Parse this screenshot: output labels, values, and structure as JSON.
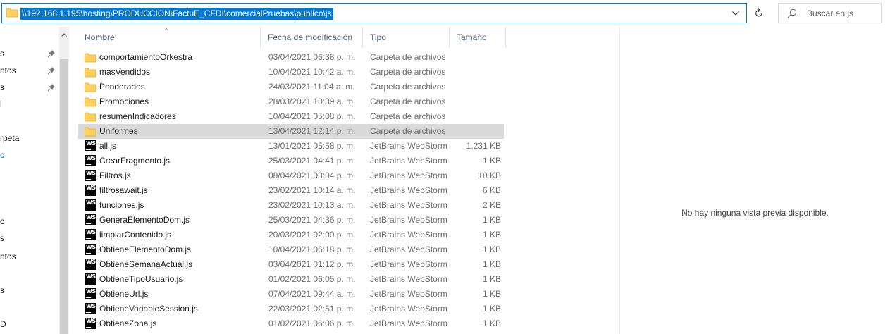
{
  "address_bar": {
    "path": "\\\\192.168.1.195\\hosting\\PRODUCCION\\FactuE_CFDI\\comercialPruebas\\publico\\js"
  },
  "search": {
    "placeholder": "Buscar en js"
  },
  "nav_pane": {
    "items": [
      {
        "label": "s",
        "pinned": true
      },
      {
        "label": "ntos",
        "pinned": true
      },
      {
        "label": "s",
        "pinned": true
      },
      {
        "label": "l",
        "pinned": false
      },
      {
        "label": "rpeta",
        "pinned": false
      },
      {
        "label": "c",
        "pinned": false,
        "blue": true
      },
      {
        "label": "o",
        "pinned": false
      },
      {
        "label": "s",
        "pinned": false
      },
      {
        "label": "ntos",
        "pinned": false
      },
      {
        "label": "s",
        "pinned": false
      },
      {
        "label": "D",
        "pinned": false
      }
    ]
  },
  "columns": {
    "name": "Nombre",
    "date": "Fecha de modificación",
    "type": "Tipo",
    "size": "Tamaño"
  },
  "files": [
    {
      "name": "comportamientoOrkestra",
      "date": "03/04/2021 06:38 p. m.",
      "type": "Carpeta de archivos",
      "size": "",
      "icon": "folder"
    },
    {
      "name": "masVendidos",
      "date": "10/04/2021 10:42 a. m.",
      "type": "Carpeta de archivos",
      "size": "",
      "icon": "folder"
    },
    {
      "name": "Ponderados",
      "date": "24/03/2021 11:04 a. m.",
      "type": "Carpeta de archivos",
      "size": "",
      "icon": "folder"
    },
    {
      "name": "Promociones",
      "date": "28/03/2021 10:39 a. m.",
      "type": "Carpeta de archivos",
      "size": "",
      "icon": "folder"
    },
    {
      "name": "resumenIndicadores",
      "date": "10/04/2021 05:08 p. m.",
      "type": "Carpeta de archivos",
      "size": "",
      "icon": "folder"
    },
    {
      "name": "Uniformes",
      "date": "13/04/2021 12:14 p. m.",
      "type": "Carpeta de archivos",
      "size": "",
      "icon": "folder",
      "selected": true
    },
    {
      "name": "all.js",
      "date": "13/01/2021 05:58 p. m.",
      "type": "JetBrains WebStorm",
      "size": "1,231 KB",
      "icon": "webstorm"
    },
    {
      "name": "CrearFragmento.js",
      "date": "25/03/2021 04:41 p. m.",
      "type": "JetBrains WebStorm",
      "size": "1 KB",
      "icon": "webstorm"
    },
    {
      "name": "Filtros.js",
      "date": "08/04/2021 03:04 p. m.",
      "type": "JetBrains WebStorm",
      "size": "10 KB",
      "icon": "webstorm"
    },
    {
      "name": "filtrosawait.js",
      "date": "23/02/2021 10:14 a. m.",
      "type": "JetBrains WebStorm",
      "size": "6 KB",
      "icon": "webstorm"
    },
    {
      "name": "funciones.js",
      "date": "23/02/2021 10:13 a. m.",
      "type": "JetBrains WebStorm",
      "size": "2 KB",
      "icon": "webstorm"
    },
    {
      "name": "GeneraElementoDom.js",
      "date": "25/03/2021 04:36 p. m.",
      "type": "JetBrains WebStorm",
      "size": "1 KB",
      "icon": "webstorm"
    },
    {
      "name": "limpiarContenido.js",
      "date": "20/03/2021 02:00 p. m.",
      "type": "JetBrains WebStorm",
      "size": "1 KB",
      "icon": "webstorm"
    },
    {
      "name": "ObtieneElementoDom.js",
      "date": "10/04/2021 06:18 p. m.",
      "type": "JetBrains WebStorm",
      "size": "1 KB",
      "icon": "webstorm"
    },
    {
      "name": "ObtieneSemanaActual.js",
      "date": "03/04/2021 01:12 p. m.",
      "type": "JetBrains WebStorm",
      "size": "1 KB",
      "icon": "webstorm"
    },
    {
      "name": "ObtieneTipoUsuario.js",
      "date": "01/02/2021 06:05 p. m.",
      "type": "JetBrains WebStorm",
      "size": "1 KB",
      "icon": "webstorm"
    },
    {
      "name": "ObtieneUrl.js",
      "date": "07/04/2021 09:44 a. m.",
      "type": "JetBrains WebStorm",
      "size": "1 KB",
      "icon": "webstorm"
    },
    {
      "name": "ObtieneVariableSession.js",
      "date": "22/03/2021 02:51 p. m.",
      "type": "JetBrains WebStorm",
      "size": "1 KB",
      "icon": "webstorm"
    },
    {
      "name": "ObtieneZona.js",
      "date": "01/02/2021 06:06 p. m.",
      "type": "JetBrains WebStorm",
      "size": "1 KB",
      "icon": "webstorm"
    }
  ],
  "preview": {
    "message": "No hay ninguna vista previa disponible."
  },
  "colors": {
    "accent": "#0078d7",
    "selected_row": "#d9d9d9",
    "folder": "#ffd15c",
    "header_text": "#4c607a"
  }
}
